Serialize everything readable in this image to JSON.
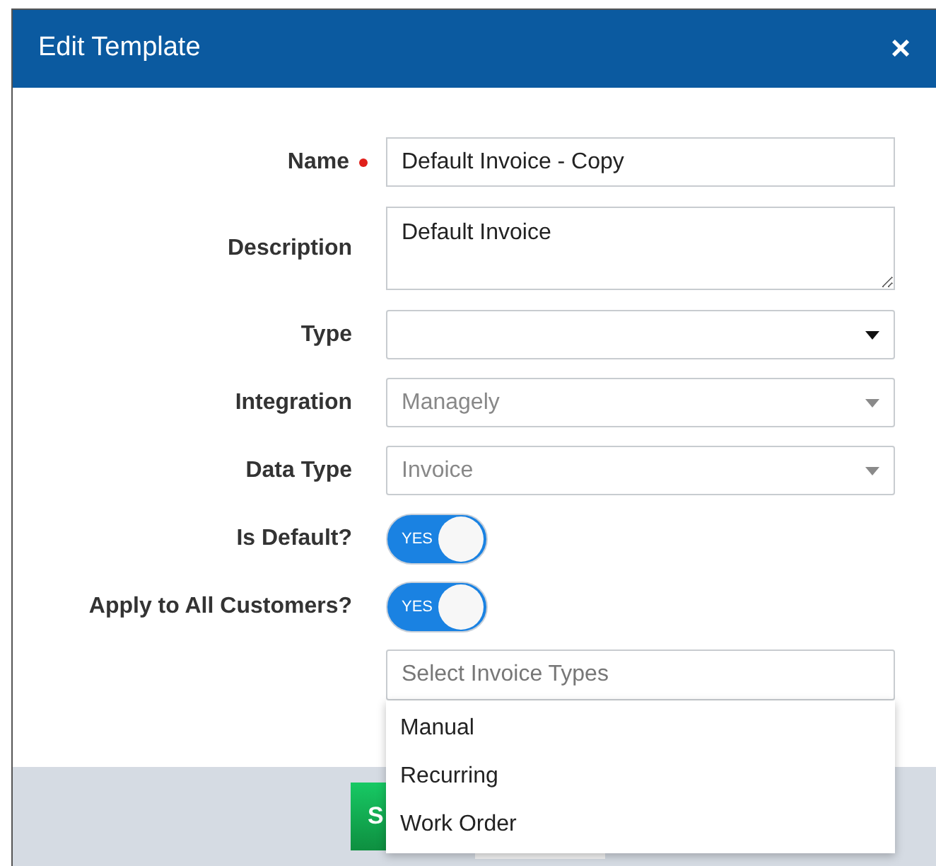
{
  "window": {
    "title": "Edit Template",
    "close": "×"
  },
  "fields": [
    {
      "kind": "text",
      "label": "Name",
      "required": true,
      "value": "Default Invoice - Copy"
    },
    {
      "kind": "textarea",
      "label": "Description",
      "required": false,
      "value": "Default Invoice"
    },
    {
      "kind": "select",
      "label": "Type",
      "required": false,
      "disabled": false
    },
    {
      "kind": "select",
      "label": "Integration",
      "required": false,
      "disabled": true,
      "value": "Managely"
    },
    {
      "kind": "select",
      "label": "Data Type",
      "required": false,
      "disabled": true,
      "value": "Invoice"
    },
    {
      "kind": "toggle",
      "label": "Is Default?",
      "on": true,
      "text": "YES"
    },
    {
      "kind": "toggle",
      "label": "Apply to All Customers?",
      "on": true,
      "text": "YES"
    }
  ],
  "invoice_types": {
    "placeholder": "Select Invoice Types",
    "options": [
      "Manual",
      "Recurring",
      "Work Order"
    ]
  },
  "footer": {
    "save_button": "S"
  }
}
